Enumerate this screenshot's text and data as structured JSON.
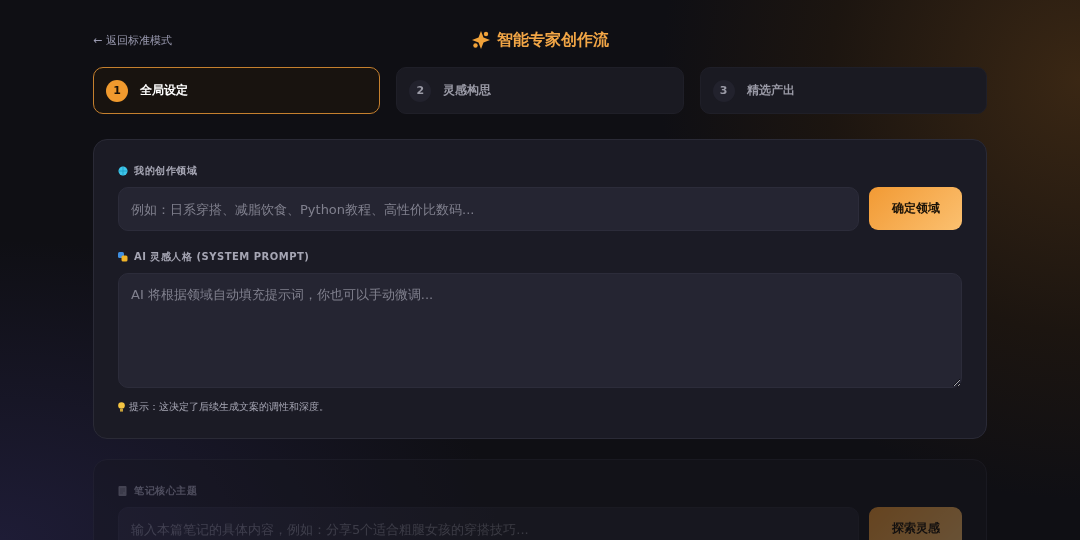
{
  "back_link": "← 返回标准模式",
  "title": "智能专家创作流",
  "steps": [
    {
      "number": "1",
      "label": "全局设定",
      "selected": true
    },
    {
      "number": "2",
      "label": "灵感构思",
      "selected": false
    },
    {
      "number": "3",
      "label": "精选产出",
      "selected": false
    }
  ],
  "cards": [
    {
      "disabled": false,
      "fields": [
        {
          "kind": "input",
          "label": "我的创作领域",
          "placeholder": "例如：日系穿搭、减脂饮食、Python教程、高性价比数码...",
          "button": "确定领域"
        },
        {
          "kind": "textarea",
          "label": "AI 灵感人格 (SYSTEM PROMPT)",
          "placeholder": "AI 将根据领域自动填充提示词，你也可以手动微调...",
          "hint": "提示：这决定了后续生成文案的调性和深度。"
        }
      ]
    },
    {
      "disabled": true,
      "fields": [
        {
          "kind": "input",
          "label": "笔记核心主题",
          "placeholder": "输入本篇笔记的具体内容，例如：分享5个适合粗腿女孩的穿搭技巧...",
          "button": "探索灵感"
        }
      ]
    }
  ]
}
